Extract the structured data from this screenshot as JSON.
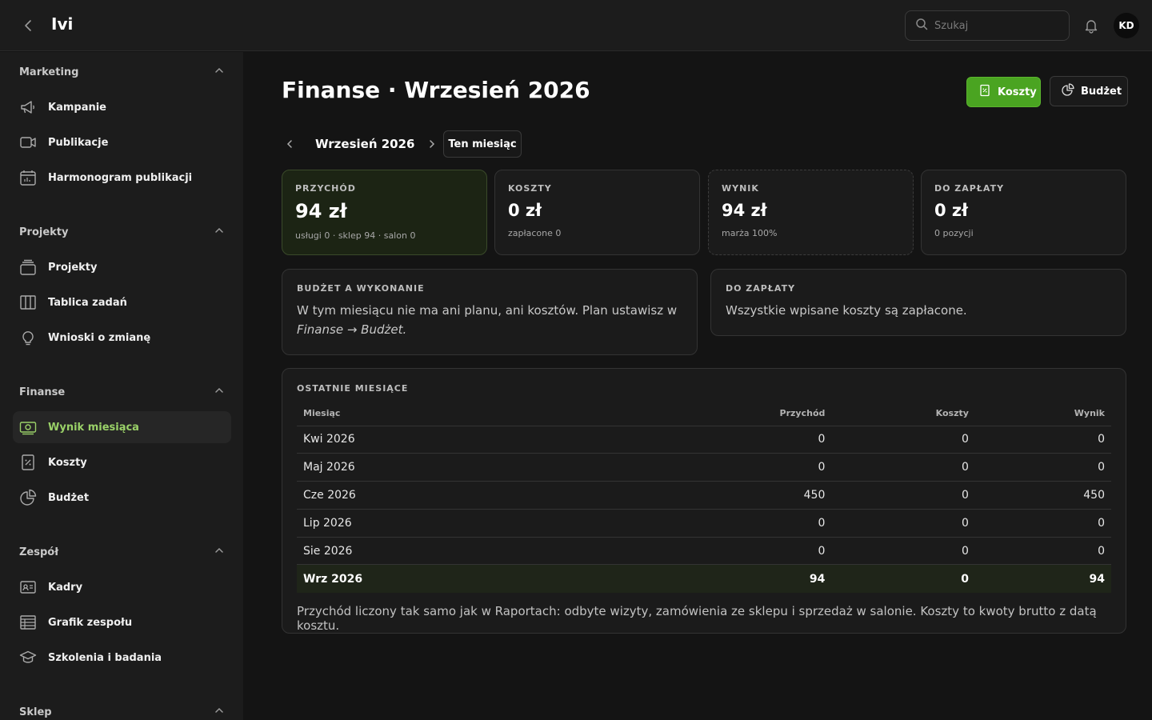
{
  "header": {
    "app_title": "Ivi",
    "search_placeholder": "Szukaj",
    "avatar_initials": "KD"
  },
  "sidebar": {
    "sections": [
      {
        "label": "Marketing",
        "items": [
          {
            "label": "Kampanie",
            "icon": "megaphone-icon"
          },
          {
            "label": "Publikacje",
            "icon": "video-icon"
          },
          {
            "label": "Harmonogram publikacji",
            "icon": "calendar-icon"
          }
        ]
      },
      {
        "label": "Projekty",
        "items": [
          {
            "label": "Projekty",
            "icon": "folder-stack-icon"
          },
          {
            "label": "Tablica zadań",
            "icon": "kanban-icon"
          },
          {
            "label": "Wnioski o zmianę",
            "icon": "lightbulb-icon"
          }
        ]
      },
      {
        "label": "Finanse",
        "items": [
          {
            "label": "Wynik miesiąca",
            "icon": "money-icon",
            "active": true
          },
          {
            "label": "Koszty",
            "icon": "receipt-icon"
          },
          {
            "label": "Budżet",
            "icon": "pie-chart-icon"
          }
        ]
      },
      {
        "label": "Zespół",
        "items": [
          {
            "label": "Kadry",
            "icon": "id-card-icon"
          },
          {
            "label": "Grafik zespołu",
            "icon": "schedule-grid-icon"
          },
          {
            "label": "Szkolenia i badania",
            "icon": "graduation-cap-icon"
          }
        ]
      },
      {
        "label": "Sklep",
        "items": []
      }
    ]
  },
  "main": {
    "title": "Finanse · Wrzesień 2026",
    "buttons": {
      "costs": "Koszty",
      "budget": "Budżet"
    },
    "month_label": "Wrzesień 2026",
    "this_month_label": "Ten miesiąc",
    "stats": [
      {
        "label": "PRZYCHÓD",
        "value": "94 zł",
        "sub": "usługi 0 · sklep 94 · salon 0"
      },
      {
        "label": "KOSZTY",
        "value": "0 zł",
        "sub": "zapłacone 0"
      },
      {
        "label": "WYNIK",
        "value": "94 zł",
        "sub": "marża 100%"
      },
      {
        "label": "DO ZAPŁATY",
        "value": "0 zł",
        "sub": "0 pozycji"
      }
    ],
    "budget_panel": {
      "label": "BUDŻET A WYKONANIE",
      "text": "W tym miesiącu nie ma ani planu, ani kosztów. Plan ustawisz w",
      "link_text": "Finanse → Budżet."
    },
    "payable_panel": {
      "label": "DO ZAPŁATY",
      "text": "Wszystkie wpisane koszty są zapłacone."
    },
    "recent": {
      "label": "OSTATNIE MIESIĄCE",
      "columns": [
        "Miesiąc",
        "Przychód",
        "Koszty",
        "Wynik"
      ],
      "rows": [
        [
          "Kwi 2026",
          "0",
          "0",
          "0"
        ],
        [
          "Maj 2026",
          "0",
          "0",
          "0"
        ],
        [
          "Cze 2026",
          "450",
          "0",
          "450"
        ],
        [
          "Lip 2026",
          "0",
          "0",
          "0"
        ],
        [
          "Sie 2026",
          "0",
          "0",
          "0"
        ],
        [
          "Wrz 2026",
          "94",
          "0",
          "94"
        ]
      ],
      "footnote": "Przychód liczony tak samo jak w Raportach: odbyte wizyty, zamówienia ze sklepu i sprzedaż w salonie. Koszty to kwoty brutto z datą kosztu."
    }
  },
  "colors": {
    "accent_green": "#4aa421",
    "active_nav_text": "#9ad168",
    "background": "#141414"
  }
}
